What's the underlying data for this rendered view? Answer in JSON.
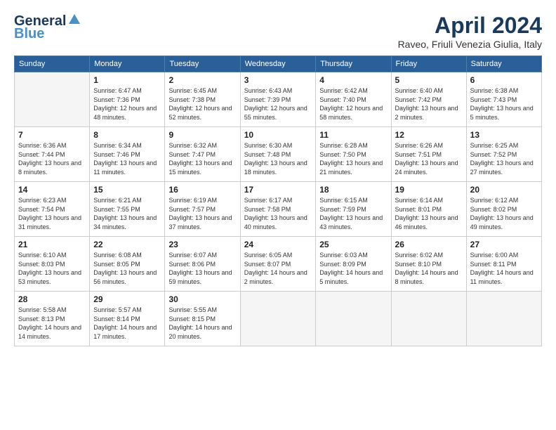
{
  "logo": {
    "line1": "General",
    "line2": "Blue"
  },
  "title": "April 2024",
  "subtitle": "Raveo, Friuli Venezia Giulia, Italy",
  "headers": [
    "Sunday",
    "Monday",
    "Tuesday",
    "Wednesday",
    "Thursday",
    "Friday",
    "Saturday"
  ],
  "weeks": [
    [
      {
        "day": "",
        "sunrise": "",
        "sunset": "",
        "daylight": ""
      },
      {
        "day": "1",
        "sunrise": "Sunrise: 6:47 AM",
        "sunset": "Sunset: 7:36 PM",
        "daylight": "Daylight: 12 hours and 48 minutes."
      },
      {
        "day": "2",
        "sunrise": "Sunrise: 6:45 AM",
        "sunset": "Sunset: 7:38 PM",
        "daylight": "Daylight: 12 hours and 52 minutes."
      },
      {
        "day": "3",
        "sunrise": "Sunrise: 6:43 AM",
        "sunset": "Sunset: 7:39 PM",
        "daylight": "Daylight: 12 hours and 55 minutes."
      },
      {
        "day": "4",
        "sunrise": "Sunrise: 6:42 AM",
        "sunset": "Sunset: 7:40 PM",
        "daylight": "Daylight: 12 hours and 58 minutes."
      },
      {
        "day": "5",
        "sunrise": "Sunrise: 6:40 AM",
        "sunset": "Sunset: 7:42 PM",
        "daylight": "Daylight: 13 hours and 2 minutes."
      },
      {
        "day": "6",
        "sunrise": "Sunrise: 6:38 AM",
        "sunset": "Sunset: 7:43 PM",
        "daylight": "Daylight: 13 hours and 5 minutes."
      }
    ],
    [
      {
        "day": "7",
        "sunrise": "Sunrise: 6:36 AM",
        "sunset": "Sunset: 7:44 PM",
        "daylight": "Daylight: 13 hours and 8 minutes."
      },
      {
        "day": "8",
        "sunrise": "Sunrise: 6:34 AM",
        "sunset": "Sunset: 7:46 PM",
        "daylight": "Daylight: 13 hours and 11 minutes."
      },
      {
        "day": "9",
        "sunrise": "Sunrise: 6:32 AM",
        "sunset": "Sunset: 7:47 PM",
        "daylight": "Daylight: 13 hours and 15 minutes."
      },
      {
        "day": "10",
        "sunrise": "Sunrise: 6:30 AM",
        "sunset": "Sunset: 7:48 PM",
        "daylight": "Daylight: 13 hours and 18 minutes."
      },
      {
        "day": "11",
        "sunrise": "Sunrise: 6:28 AM",
        "sunset": "Sunset: 7:50 PM",
        "daylight": "Daylight: 13 hours and 21 minutes."
      },
      {
        "day": "12",
        "sunrise": "Sunrise: 6:26 AM",
        "sunset": "Sunset: 7:51 PM",
        "daylight": "Daylight: 13 hours and 24 minutes."
      },
      {
        "day": "13",
        "sunrise": "Sunrise: 6:25 AM",
        "sunset": "Sunset: 7:52 PM",
        "daylight": "Daylight: 13 hours and 27 minutes."
      }
    ],
    [
      {
        "day": "14",
        "sunrise": "Sunrise: 6:23 AM",
        "sunset": "Sunset: 7:54 PM",
        "daylight": "Daylight: 13 hours and 31 minutes."
      },
      {
        "day": "15",
        "sunrise": "Sunrise: 6:21 AM",
        "sunset": "Sunset: 7:55 PM",
        "daylight": "Daylight: 13 hours and 34 minutes."
      },
      {
        "day": "16",
        "sunrise": "Sunrise: 6:19 AM",
        "sunset": "Sunset: 7:57 PM",
        "daylight": "Daylight: 13 hours and 37 minutes."
      },
      {
        "day": "17",
        "sunrise": "Sunrise: 6:17 AM",
        "sunset": "Sunset: 7:58 PM",
        "daylight": "Daylight: 13 hours and 40 minutes."
      },
      {
        "day": "18",
        "sunrise": "Sunrise: 6:15 AM",
        "sunset": "Sunset: 7:59 PM",
        "daylight": "Daylight: 13 hours and 43 minutes."
      },
      {
        "day": "19",
        "sunrise": "Sunrise: 6:14 AM",
        "sunset": "Sunset: 8:01 PM",
        "daylight": "Daylight: 13 hours and 46 minutes."
      },
      {
        "day": "20",
        "sunrise": "Sunrise: 6:12 AM",
        "sunset": "Sunset: 8:02 PM",
        "daylight": "Daylight: 13 hours and 49 minutes."
      }
    ],
    [
      {
        "day": "21",
        "sunrise": "Sunrise: 6:10 AM",
        "sunset": "Sunset: 8:03 PM",
        "daylight": "Daylight: 13 hours and 53 minutes."
      },
      {
        "day": "22",
        "sunrise": "Sunrise: 6:08 AM",
        "sunset": "Sunset: 8:05 PM",
        "daylight": "Daylight: 13 hours and 56 minutes."
      },
      {
        "day": "23",
        "sunrise": "Sunrise: 6:07 AM",
        "sunset": "Sunset: 8:06 PM",
        "daylight": "Daylight: 13 hours and 59 minutes."
      },
      {
        "day": "24",
        "sunrise": "Sunrise: 6:05 AM",
        "sunset": "Sunset: 8:07 PM",
        "daylight": "Daylight: 14 hours and 2 minutes."
      },
      {
        "day": "25",
        "sunrise": "Sunrise: 6:03 AM",
        "sunset": "Sunset: 8:09 PM",
        "daylight": "Daylight: 14 hours and 5 minutes."
      },
      {
        "day": "26",
        "sunrise": "Sunrise: 6:02 AM",
        "sunset": "Sunset: 8:10 PM",
        "daylight": "Daylight: 14 hours and 8 minutes."
      },
      {
        "day": "27",
        "sunrise": "Sunrise: 6:00 AM",
        "sunset": "Sunset: 8:11 PM",
        "daylight": "Daylight: 14 hours and 11 minutes."
      }
    ],
    [
      {
        "day": "28",
        "sunrise": "Sunrise: 5:58 AM",
        "sunset": "Sunset: 8:13 PM",
        "daylight": "Daylight: 14 hours and 14 minutes."
      },
      {
        "day": "29",
        "sunrise": "Sunrise: 5:57 AM",
        "sunset": "Sunset: 8:14 PM",
        "daylight": "Daylight: 14 hours and 17 minutes."
      },
      {
        "day": "30",
        "sunrise": "Sunrise: 5:55 AM",
        "sunset": "Sunset: 8:15 PM",
        "daylight": "Daylight: 14 hours and 20 minutes."
      },
      {
        "day": "",
        "sunrise": "",
        "sunset": "",
        "daylight": ""
      },
      {
        "day": "",
        "sunrise": "",
        "sunset": "",
        "daylight": ""
      },
      {
        "day": "",
        "sunrise": "",
        "sunset": "",
        "daylight": ""
      },
      {
        "day": "",
        "sunrise": "",
        "sunset": "",
        "daylight": ""
      }
    ]
  ]
}
